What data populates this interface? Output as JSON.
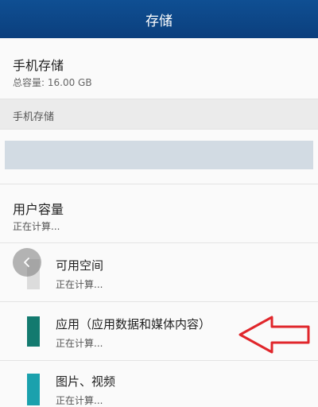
{
  "header": {
    "title": "存储"
  },
  "device_storage": {
    "title": "手机存储",
    "total": "总容量: 16.00 GB"
  },
  "section_header": {
    "label": "手机存储"
  },
  "user_capacity": {
    "title": "用户容量",
    "status": "正在计算..."
  },
  "categories": [
    {
      "label": "可用空间",
      "status": "正在计算...",
      "color": "#dcdcdc"
    },
    {
      "label": "应用（应用数据和媒体内容）",
      "status": "正在计算...",
      "color": "#137a6f"
    },
    {
      "label": "图片、视频",
      "status": "正在计算...",
      "color": "#1ba1ad"
    }
  ],
  "colors": {
    "header_bg": "#0b3f7d",
    "annotation_arrow": "#e0262b"
  },
  "icons": {
    "back": "chevron-left-icon"
  }
}
